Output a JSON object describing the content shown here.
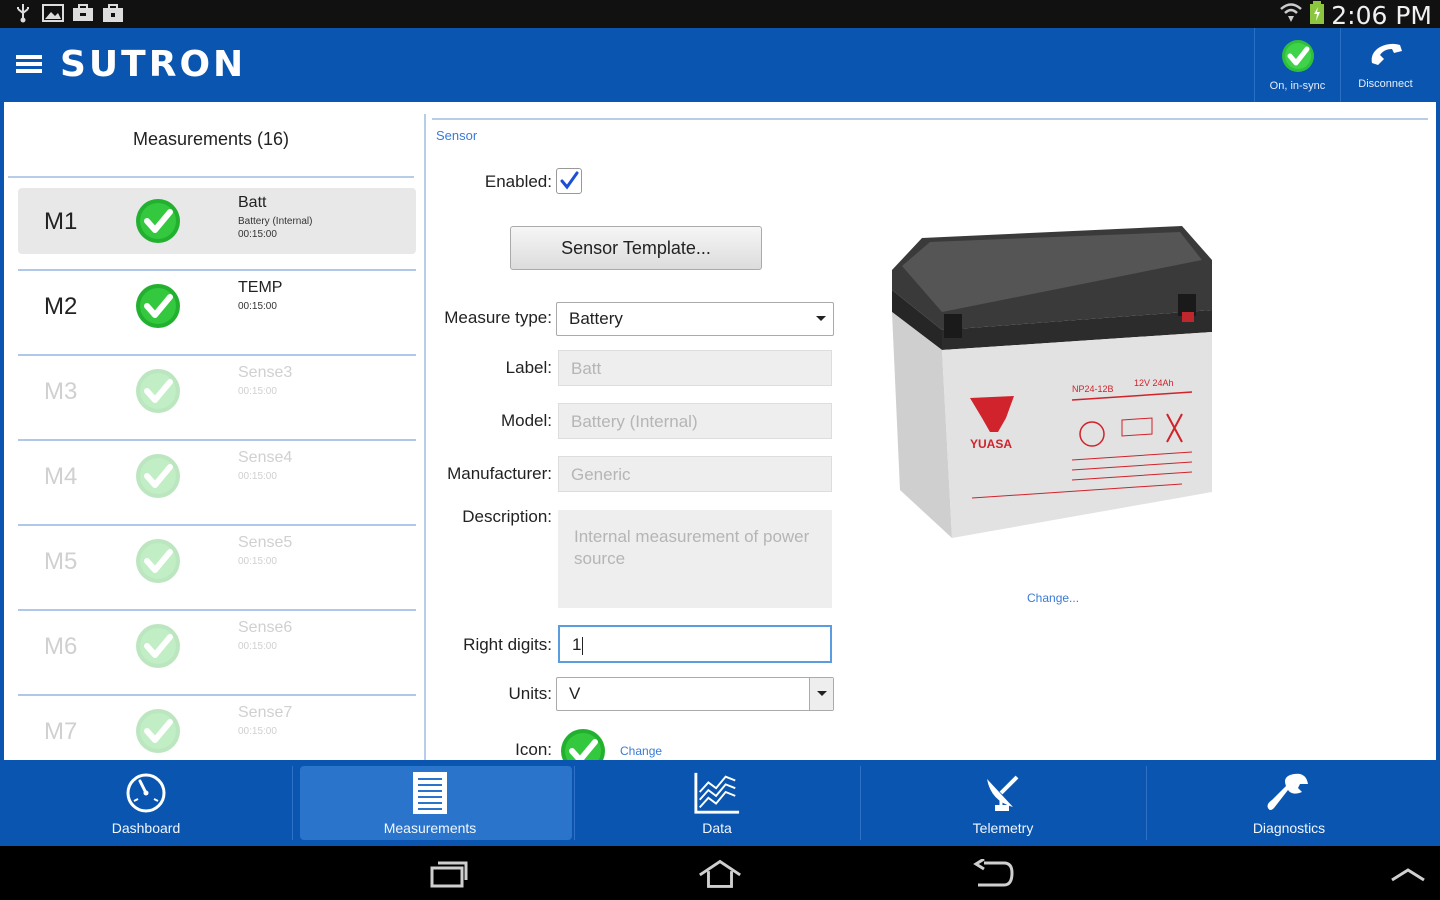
{
  "status_bar": {
    "time": "2:06 PM",
    "icons": [
      "usb-icon",
      "image-icon",
      "briefcase-icon",
      "bag-icon",
      "wifi-icon",
      "battery-charging-icon"
    ]
  },
  "app_bar": {
    "brand": "SUTRON",
    "sync_label": "On, in-sync",
    "disconnect_label": "Disconnect"
  },
  "measurements": {
    "header": "Measurements (16)",
    "items": [
      {
        "id": "M1",
        "title": "Batt",
        "sub1": "Battery (Internal)",
        "sub2": "00:15:00",
        "enabled": true,
        "selected": true
      },
      {
        "id": "M2",
        "title": "TEMP",
        "sub1": "00:15:00",
        "sub2": "",
        "enabled": true,
        "selected": false
      },
      {
        "id": "M3",
        "title": "Sense3",
        "sub1": "00:15:00",
        "sub2": "",
        "enabled": false,
        "selected": false
      },
      {
        "id": "M4",
        "title": "Sense4",
        "sub1": "00:15:00",
        "sub2": "",
        "enabled": false,
        "selected": false
      },
      {
        "id": "M5",
        "title": "Sense5",
        "sub1": "00:15:00",
        "sub2": "",
        "enabled": false,
        "selected": false
      },
      {
        "id": "M6",
        "title": "Sense6",
        "sub1": "00:15:00",
        "sub2": "",
        "enabled": false,
        "selected": false
      },
      {
        "id": "M7",
        "title": "Sense7",
        "sub1": "00:15:00",
        "sub2": "",
        "enabled": false,
        "selected": false
      }
    ]
  },
  "sensor": {
    "section_title": "Sensor",
    "enabled_label": "Enabled:",
    "enabled": true,
    "template_button": "Sensor Template...",
    "measure_type_label": "Measure type:",
    "measure_type_value": "Battery",
    "label_label": "Label:",
    "label_value": "Batt",
    "model_label": "Model:",
    "model_value": "Battery (Internal)",
    "manufacturer_label": "Manufacturer:",
    "manufacturer_value": "Generic",
    "description_label": "Description:",
    "description_value": "Internal measurement of power source",
    "right_digits_label": "Right digits:",
    "right_digits_value": "1",
    "units_label": "Units:",
    "units_value": "V",
    "icon_label": "Icon:",
    "icon_change": "Change",
    "image_change": "Change...",
    "battery_brand": "YUASA",
    "battery_model": "NP24-12B",
    "battery_rating": "12V 24Ah"
  },
  "bottom_nav": [
    {
      "label": "Dashboard",
      "icon": "gauge-icon",
      "active": false
    },
    {
      "label": "Measurements",
      "icon": "list-icon",
      "active": true
    },
    {
      "label": "Data",
      "icon": "chart-icon",
      "active": false
    },
    {
      "label": "Telemetry",
      "icon": "satellite-icon",
      "active": false
    },
    {
      "label": "Diagnostics",
      "icon": "wrench-icon",
      "active": false
    }
  ],
  "colors": {
    "brand_blue": "#0a55b0",
    "check_green": "#2fbf3a",
    "link_blue": "#3a7bd5"
  }
}
